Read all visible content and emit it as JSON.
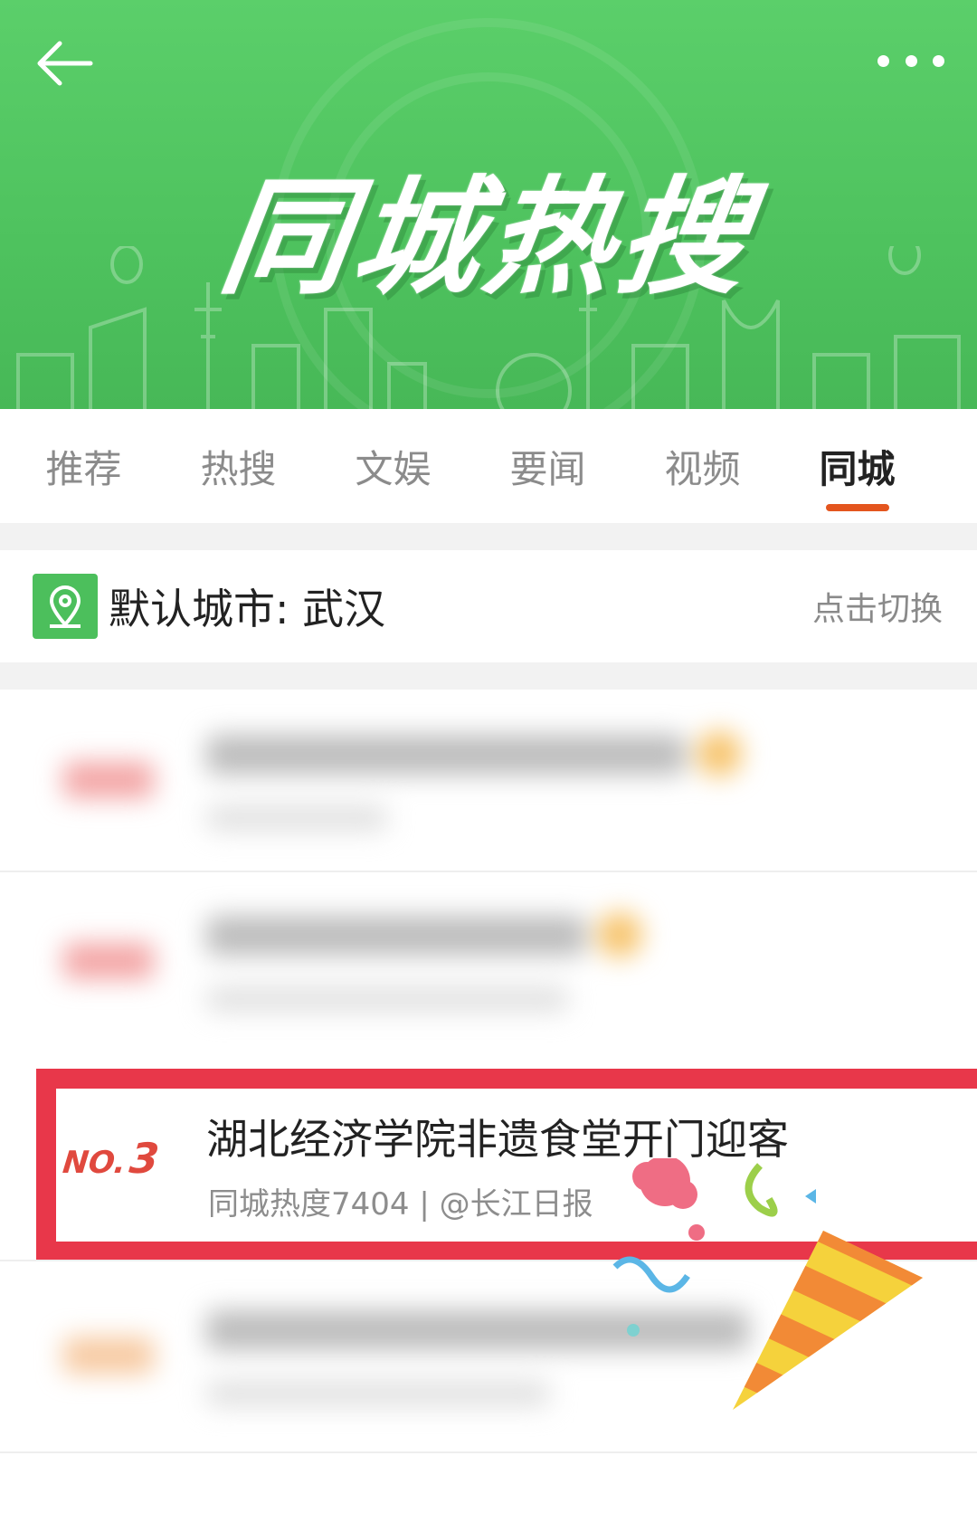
{
  "header": {
    "title": "同城热搜"
  },
  "tabs": [
    {
      "label": "推荐"
    },
    {
      "label": "热搜"
    },
    {
      "label": "文娱"
    },
    {
      "label": "要闻"
    },
    {
      "label": "视频"
    },
    {
      "label": "同城"
    }
  ],
  "active_tab": "同城",
  "city": {
    "label": "默认城市: 武汉",
    "switch_label": "点击切换"
  },
  "hot_list": {
    "highlighted_item": {
      "rank_prefix": "NO.",
      "rank": "3",
      "title": "湖北经济学院非遗食堂开门迎客",
      "meta": "同城热度7404 | @长江日报"
    }
  },
  "colors": {
    "banner_green": "#4ec25e",
    "tab_active_underline": "#e4551e",
    "highlight_border": "#e8374a",
    "rank_red": "#e0493e"
  },
  "icons": [
    "back-arrow-icon",
    "more-dots-icon",
    "location-pin-icon",
    "party-popper-icon"
  ]
}
